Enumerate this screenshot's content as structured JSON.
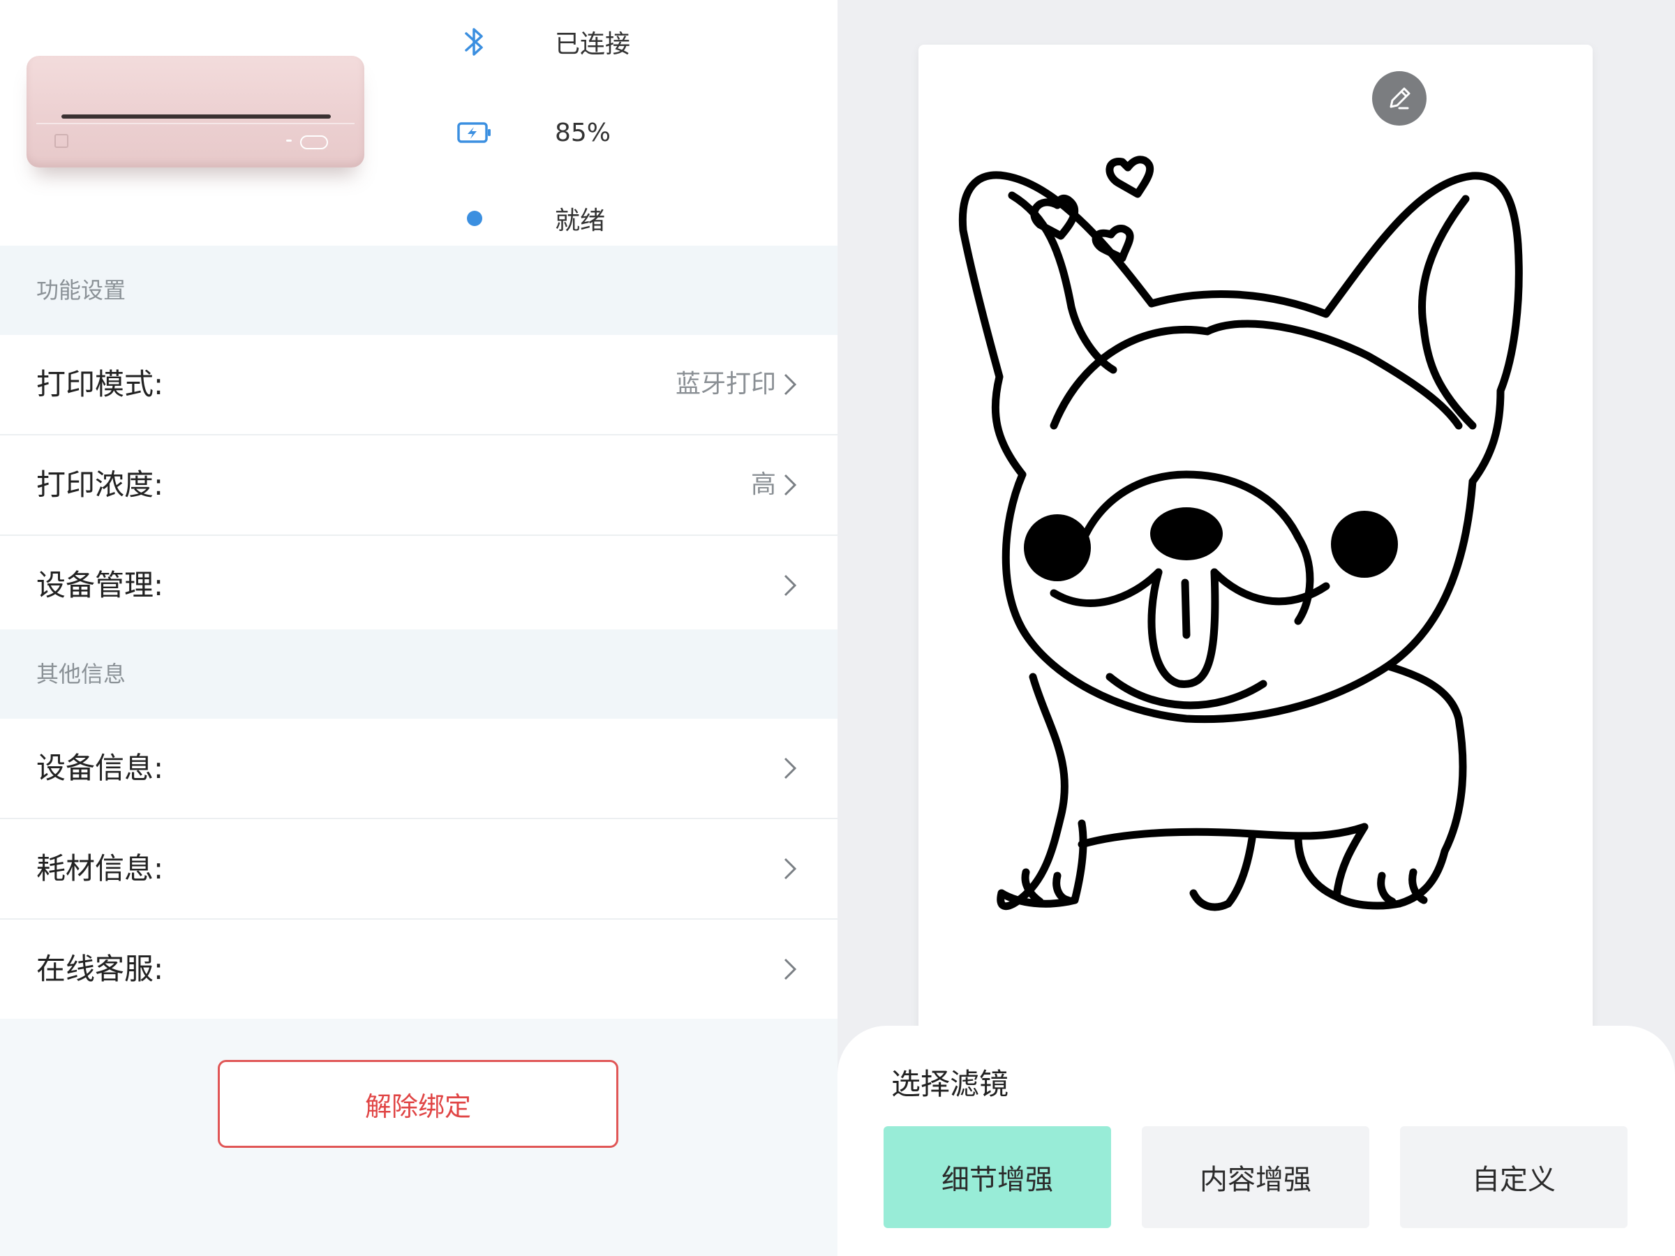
{
  "device": {
    "connection_status": "已连接",
    "battery": "85%",
    "state": "就绪",
    "colors": {
      "icon_blue": "#3b8fe0",
      "printer_pink": "#ecd0d1"
    }
  },
  "sections": [
    {
      "title": "功能设置",
      "items": [
        {
          "label": "打印模式:",
          "value": "蓝牙打印"
        },
        {
          "label": "打印浓度:",
          "value": "高"
        },
        {
          "label": "设备管理:",
          "value": ""
        }
      ]
    },
    {
      "title": "其他信息",
      "items": [
        {
          "label": "设备信息:",
          "value": ""
        },
        {
          "label": "耗材信息:",
          "value": ""
        },
        {
          "label": "在线客服:",
          "value": ""
        }
      ]
    }
  ],
  "unbind_label": "解除绑定",
  "unbind_color": "#e04545",
  "filters": {
    "title": "选择滤镜",
    "options": [
      "细节增强",
      "内容增强",
      "自定义"
    ],
    "selected": "细节增强",
    "active_color": "#98ecd7"
  },
  "icons": {
    "bluetooth": "bluetooth-icon",
    "battery": "battery-charging-icon",
    "status": "status-dot-icon",
    "chevron": "chevron-right-icon",
    "edit": "pencil-icon"
  }
}
